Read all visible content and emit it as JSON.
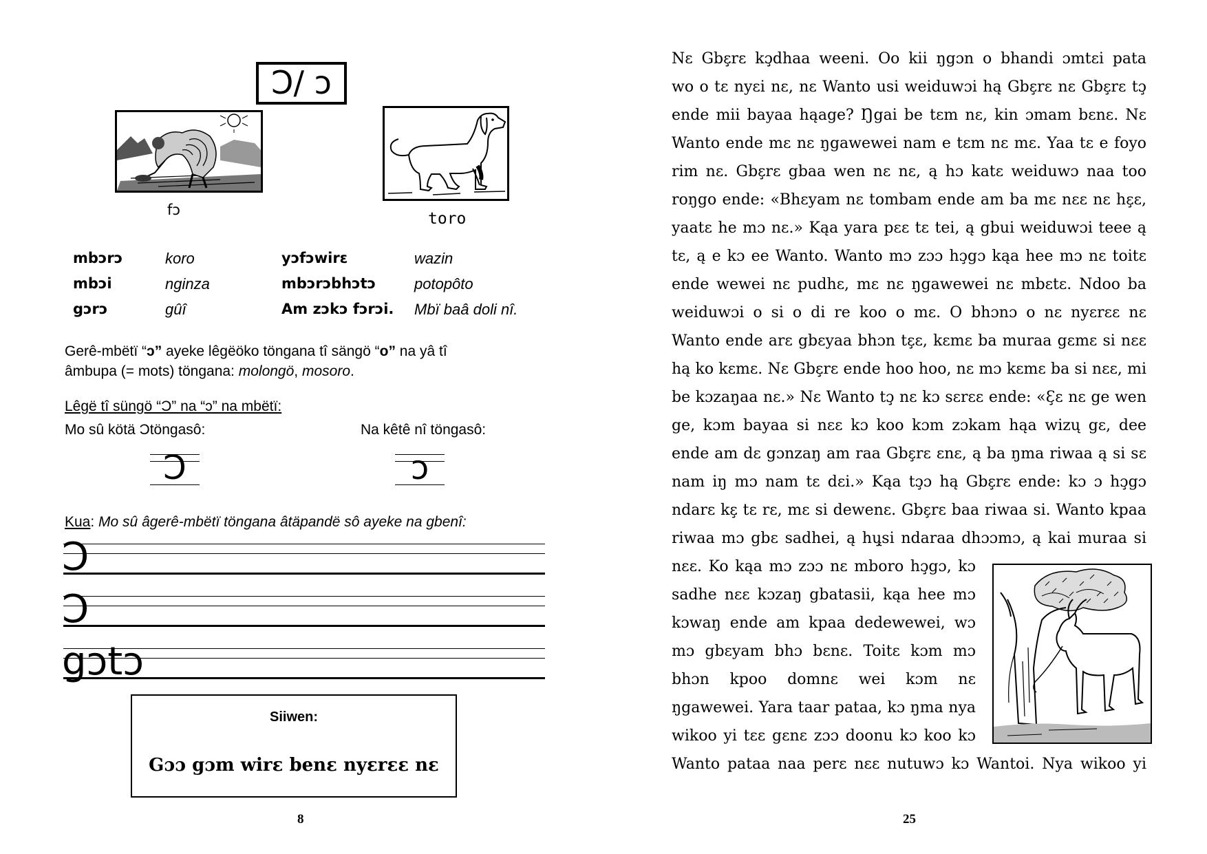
{
  "left_page": {
    "letter_heading": "Ɔ/ ɔ",
    "pictures": [
      {
        "name": "woman-bending-illustration",
        "caption": "fɔ"
      },
      {
        "name": "dog-illustration",
        "caption": "toro"
      }
    ],
    "vocab": [
      {
        "word": "mbɔrɔ",
        "translation": "koro",
        "word2": "yɔfɔwirɛ",
        "translation2": "wazin"
      },
      {
        "word": "mbɔi",
        "translation": "nginza",
        "word2": "mbɔrɔbhɔtɔ",
        "translation2": "potopôto"
      },
      {
        "word": "gɔrɔ",
        "translation": "gûî",
        "word2": "Am zɔkɔ fɔrɔi.",
        "translation2": "Mbï baâ doli nî."
      }
    ],
    "explanation_a": "Gerê-mbëtï “",
    "explanation_b": "ɔ”",
    "explanation_c": " ayeke lêgëöko töngana tî sängö “",
    "explanation_d": "o”",
    "explanation_e": " na yâ tî",
    "explanation_line2_a": "âmbupa (= mots) töngana: ",
    "explanation_line2_b": "molongö",
    "explanation_line2_c": ", ",
    "explanation_line2_d": "mosoro",
    "explanation_line2_e": ".",
    "writing_heading": "Lêgë tî süngö “Ɔ” na “ɔ” na mbëtï:",
    "upper_label": "Mo sû kötä Ɔtöngasô:",
    "lower_label": "Na kêtê nî töngasô:",
    "upper_glyph": "Ɔ",
    "lower_glyph": "ɔ",
    "exercise_label": "Kua",
    "exercise_sep": ": ",
    "exercise_text": "Mo sû âgerê-mbëtï töngana âtäpandë sô ayeke na gbenî:",
    "practice_rows": [
      "Ɔ",
      "Ɔ",
      "gɔtɔ"
    ],
    "siiwen_title": "Siiwen:",
    "siiwen_text": "Gɔɔ gɔm wirɛ benɛ nyɛrɛɛ nɛ",
    "page_number": "8"
  },
  "right_page": {
    "lines": [
      "Nɛ Gbɛ̧rɛ kɔ̧dhaa weeni. Oo kii ŋgɔn o bhandi ɔmtɛi pata",
      "wo o tɛ nyɛi nɛ, nɛ Wanto usi weiduwɔi hą Gbɛ̧rɛ nɛ Gbɛ̧rɛ tɔ̧",
      "ende mii bayaa hąage? Ŋgai be tɛm nɛ, kin ɔmam bɛnɛ. Nɛ",
      "Wanto ende mɛ nɛ ŋgawewei nam e tɛm nɛ mɛ. Yaa tɛ e foyo",
      "rim nɛ. Gbɛ̧rɛ gbaa wen nɛ nɛ, ą hɔ katɛ weiduwɔ naa too",
      "roŋgo ende: «Bhɛyam nɛ tombam ende am ba mɛ nɛɛ nɛ hɛ̧ɛ,",
      "yaatɛ he mɔ nɛ.» Kąa yara pɛɛ tɛ tei, ą gbui weiduwɔi teee ą",
      "tɛ, ą e kɔ ee Wanto. Wanto mɔ zɔɔ hɔ̧gɔ kąa hee mɔ nɛ toitɛ",
      "ende wewei nɛ pudhɛ, mɛ nɛ ŋgawewei nɛ mbɛtɛ. Ndoo ba",
      "weiduwɔi o si o di re koo o mɛ. O bhɔnɔ o nɛ nyɛrɛɛ nɛ",
      "Wanto ende arɛ gbɛyaa bhɔn tɛ̧ɛ, kɛmɛ ba muraa gɛmɛ si nɛɛ",
      "hą ko kɛmɛ. Nɛ Gbɛ̧rɛ ende hoo hoo, nɛ mɔ kɛmɛ ba si nɛɛ, mi",
      "be kɔzaŋaa nɛ.» Nɛ Wanto tɔ̧ nɛ kɔ sɛrɛɛ ende: «Ɛ̧ɛ nɛ ge wen",
      "ge, kɔm bayaa si nɛɛ kɔ koo kɔm zɔkam hąa wizų gɛ, dee",
      "ende am dɛ gɔnzaŋ am raa Gbɛ̧rɛ ɛnɛ, ą ba ŋma riwaa ą si sɛ",
      "nam iŋ mɔ nam tɛ dɛi.» Kąa tɔ̧ɔ hą Gbɛ̧rɛ ende: kɔ ɔ hɔ̧gɔ",
      "ndarɛ kɛ̧ tɛ rɛ, mɛ si dewenɛ. Gbɛ̧rɛ baa riwaa si. Wanto kpaa",
      "riwaa mɔ gbɛ sadhei, ą hų̧si ndaraa dhɔɔmɔ, ą kai muraa si",
      "nɛɛ. Ko kąa mɔ zɔɔ nɛ mboro hɔ̧gɔ, kɔ",
      "sadhe nɛɛ kɔzaŋ gbatasii, kąa hee mɔ",
      "kɔwaŋ ende am kpaa dedewewei, wɔ",
      "mɔ gbɛyam bhɔ bɛnɛ. Toitɛ kɔm mɔ",
      "bhɔn kpoo domnɛ wei kɔm nɛ",
      "ŋgawewei. Yara taar pataa, kɔ ŋma nya",
      "wikoo yi tɛɛ gɛnɛ zɔɔ doonu kɔ koo kɔ",
      "Wanto pataa naa perɛ nɛɛ nutuwɔ kɔ Wantoi. Nya wikoo yi"
    ],
    "picture": "goat-tied-to-tree-illustration",
    "page_number": "25"
  }
}
